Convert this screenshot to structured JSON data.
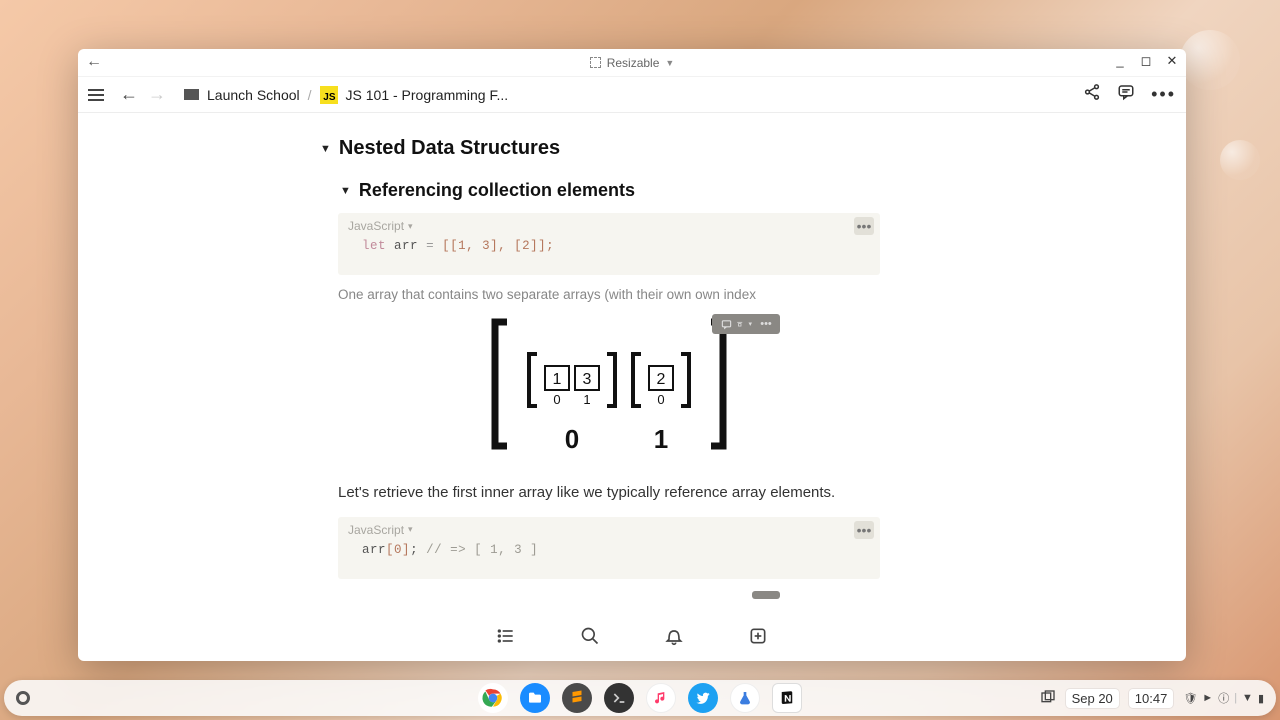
{
  "titlebar": {
    "mode_label": "Resizable"
  },
  "breadcrumb": {
    "root": "Launch School",
    "page": "JS 101 - Programming F...",
    "page_icon_label": "JS"
  },
  "content": {
    "h1": "Nested Data Structures",
    "h2": "Referencing collection elements",
    "code1_lang": "JavaScript",
    "code1_let": "let",
    "code1_var": "arr",
    "code1_eq": "=",
    "code1_rest": "[[1, 3], [2]];",
    "caption1": "One array that contains two separate arrays (with their own own index",
    "body1": "Let's retrieve the first inner array like we typically reference array elements.",
    "code2_lang": "JavaScript",
    "code2_text": "arr[0]; // => [ 1, 3 ]",
    "diagram": {
      "inner_a": [
        "1",
        "3"
      ],
      "inner_a_idx": [
        "0",
        "1"
      ],
      "inner_b": [
        "2"
      ],
      "inner_b_idx": [
        "0"
      ],
      "outer_idx": [
        "0",
        "1"
      ]
    }
  },
  "chart_data": {
    "type": "table",
    "title": "Nested array diagram",
    "outer": [
      {
        "index": 0,
        "value": [
          {
            "index": 0,
            "value": 1
          },
          {
            "index": 1,
            "value": 3
          }
        ]
      },
      {
        "index": 1,
        "value": [
          {
            "index": 0,
            "value": 2
          }
        ]
      }
    ]
  },
  "taskbar": {
    "date": "Sep 20",
    "time": "10:47"
  }
}
